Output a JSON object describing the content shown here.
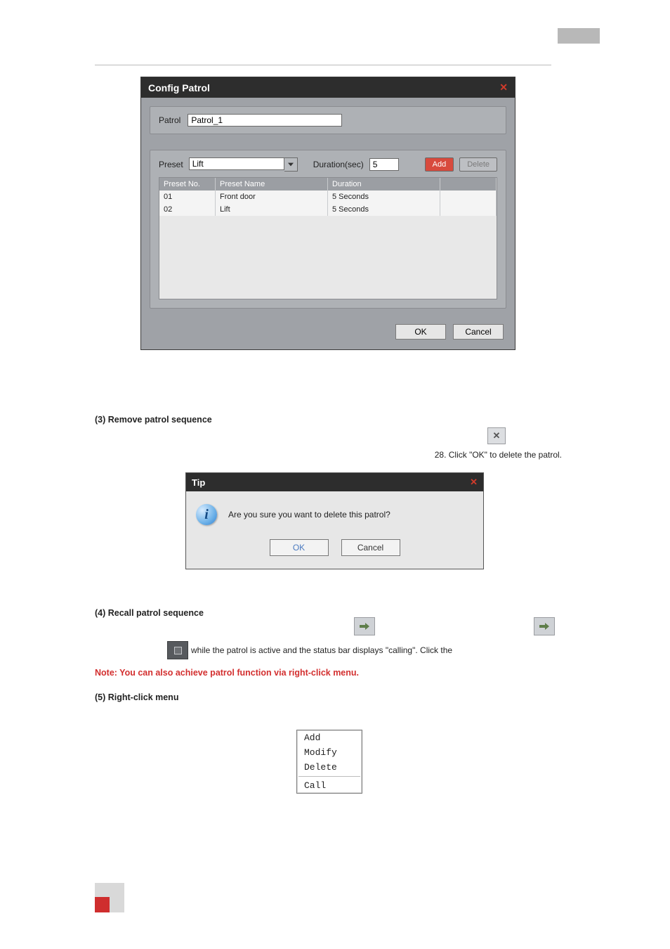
{
  "config_patrol": {
    "title": "Config Patrol",
    "patrol_label": "Patrol",
    "patrol_value": "Patrol_1",
    "preset_label": "Preset",
    "preset_value": "Lift",
    "duration_label": "Duration(sec)",
    "duration_value": "5",
    "add_label": "Add",
    "delete_label": "Delete",
    "headers": {
      "no": "Preset No.",
      "name": "Preset Name",
      "dur": "Duration"
    },
    "rows": [
      {
        "no": "01",
        "name": "Front door",
        "dur": "5 Seconds"
      },
      {
        "no": "02",
        "name": "Lift",
        "dur": "5 Seconds"
      }
    ],
    "ok": "OK",
    "cancel": "Cancel"
  },
  "section3": {
    "heading": "(3) Remove patrol sequence",
    "caption": "28. Click \"OK\" to delete the patrol."
  },
  "tip": {
    "title": "Tip",
    "message": "Are you sure you want to delete this patrol?",
    "ok": "OK",
    "cancel": "Cancel"
  },
  "section4": {
    "heading": "(4) Recall patrol sequence",
    "line": " while the patrol is active and the status bar displays \"calling\". Click the "
  },
  "note": "Note: You can also achieve patrol function via right-click menu.",
  "section5": {
    "heading": "(5) Right-click menu"
  },
  "ctx": {
    "add": "Add",
    "modify": "Modify",
    "delete": "Delete",
    "call": "Call"
  }
}
